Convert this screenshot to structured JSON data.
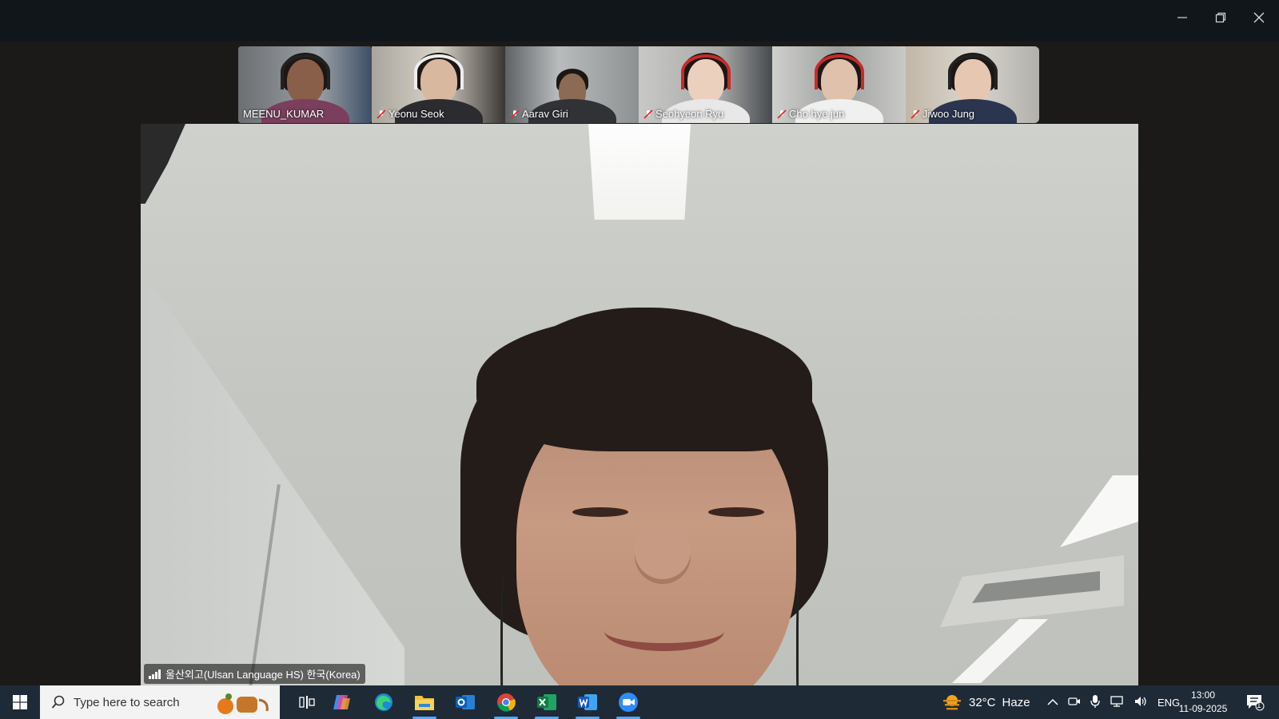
{
  "window": {
    "controls": {
      "minimize": "minimize-icon",
      "maximize": "restore-icon",
      "close": "close-icon"
    }
  },
  "participants": [
    {
      "name": "MEENU_KUMAR",
      "muted": false,
      "active": true
    },
    {
      "name": "Yeonu Seok",
      "muted": true,
      "active": false
    },
    {
      "name": "Aarav Giri",
      "muted": true,
      "active": false
    },
    {
      "name": "Seohyeon Ryu",
      "muted": true,
      "active": false
    },
    {
      "name": "Cho hye jun",
      "muted": true,
      "active": false
    },
    {
      "name": "Jiwoo Jung",
      "muted": true,
      "active": false
    }
  ],
  "main_video": {
    "label": "울산외고(Ulsan Language HS) 한국(Korea)"
  },
  "taskbar": {
    "search_placeholder": "Type here to search",
    "apps": [
      "copilot-icon",
      "edge-icon",
      "file-explorer-icon",
      "outlook-icon",
      "chrome-icon",
      "excel-icon",
      "word-icon",
      "zoom-icon"
    ],
    "weather": {
      "temp": "32°C",
      "condition": "Haze"
    },
    "language": "ENG",
    "time": "13:00",
    "date": "11-09-2025",
    "notifications": "1"
  },
  "colors": {
    "active_speaker": "#23d18b",
    "taskbar": "#1f2a37",
    "indicator": "#4fa9ff"
  }
}
